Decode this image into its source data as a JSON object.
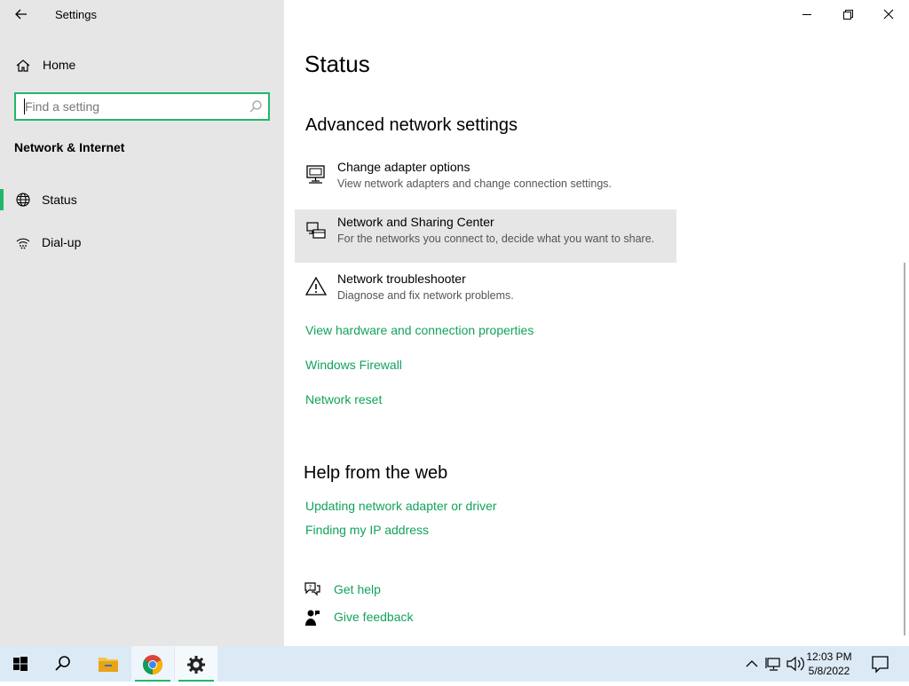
{
  "window": {
    "title": "Settings"
  },
  "sidebar": {
    "home": "Home",
    "search_placeholder": "Find a setting",
    "section": "Network & Internet",
    "items": [
      {
        "label": "Status",
        "icon": "globe-icon",
        "active": true
      },
      {
        "label": "Dial-up",
        "icon": "dialup-icon",
        "active": false
      }
    ]
  },
  "main": {
    "title": "Status",
    "advanced_heading": "Advanced network settings",
    "items": [
      {
        "title": "Change adapter options",
        "desc": "View network adapters and change connection settings.",
        "icon": "adapter-icon"
      },
      {
        "title": "Network and Sharing Center",
        "desc": "For the networks you connect to, decide what you want to share.",
        "icon": "sharing-center-icon"
      },
      {
        "title": "Network troubleshooter",
        "desc": "Diagnose and fix network problems.",
        "icon": "warning-icon"
      }
    ],
    "links": [
      "View hardware and connection properties",
      "Windows Firewall",
      "Network reset"
    ],
    "help_heading": "Help from the web",
    "help_links": [
      "Updating network adapter or driver",
      "Finding my IP address"
    ],
    "get_help": "Get help",
    "give_feedback": "Give feedback"
  },
  "taskbar": {
    "time": "12:03 PM",
    "date": "5/8/2022"
  },
  "colors": {
    "accent": "#1fb86a",
    "link": "#12a25a",
    "sidebar_bg": "#e6e6e6",
    "taskbar_bg": "#dceaf6"
  }
}
